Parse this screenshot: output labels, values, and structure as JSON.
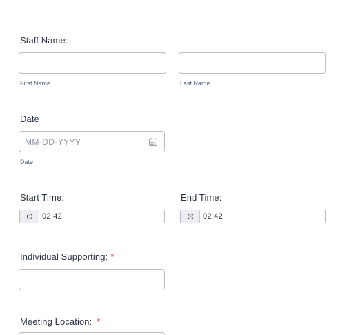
{
  "staff_name": {
    "label": "Staff Name:",
    "first_sublabel": "First Name",
    "last_sublabel": "Last Name",
    "first_value": "",
    "last_value": ""
  },
  "date": {
    "label": "Date",
    "placeholder": "MM-DD-YYYY",
    "sublabel": "Date",
    "icon": "calendar-icon"
  },
  "start_time": {
    "label": "Start Time:",
    "value": "02:42",
    "icon": "clock-icon"
  },
  "end_time": {
    "label": "End Time:",
    "value": "02:42",
    "icon": "clock-icon"
  },
  "individual_supporting": {
    "label": "Individual Supporting:",
    "required_mark": "*",
    "value": ""
  },
  "meeting_location": {
    "label": "Meeting Location:",
    "required_mark": "*"
  },
  "colors": {
    "required": "#d0353c",
    "text": "#2c3345",
    "border": "#b8bdc9"
  }
}
